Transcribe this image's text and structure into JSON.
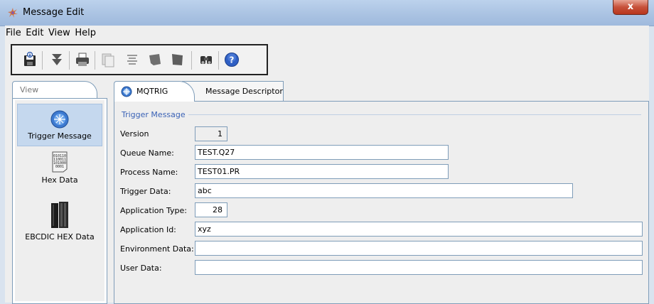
{
  "window": {
    "title": "Message Edit",
    "close_label": "x"
  },
  "menu": {
    "items": [
      "File",
      "Edit",
      "View",
      "Help"
    ]
  },
  "toolbar": {
    "icons": [
      "save-icon",
      "download-icon",
      "print-icon",
      "copy-icon",
      "align-icon",
      "paste-icon",
      "delete-icon",
      "find-icon",
      "help-icon"
    ]
  },
  "left_panel": {
    "tab_label": "View",
    "items": [
      {
        "label": "Trigger Message",
        "icon": "trigger-message-icon",
        "selected": true
      },
      {
        "label": "Hex Data",
        "icon": "hex-data-icon",
        "selected": false
      },
      {
        "label": "EBCDIC HEX Data",
        "icon": "ebcdic-hex-data-icon",
        "selected": false
      }
    ]
  },
  "tabs": [
    {
      "label": "MQTRIG",
      "active": true
    },
    {
      "label": "Message Descriptor",
      "active": false
    }
  ],
  "form": {
    "section_title": "Trigger Message",
    "fields": {
      "version": {
        "label": "Version",
        "value": "1"
      },
      "queue_name": {
        "label": "Queue Name:",
        "value": "TEST.Q27"
      },
      "process_name": {
        "label": "Process Name:",
        "value": "TEST01.PR"
      },
      "trigger_data": {
        "label": "Trigger Data:",
        "value": "abc"
      },
      "application_type": {
        "label": "Application Type:",
        "value": "28"
      },
      "application_id": {
        "label": "Application Id:",
        "value": "xyz"
      },
      "environment_data": {
        "label": "Environment Data:",
        "value": ""
      },
      "user_data": {
        "label": "User Data:",
        "value": ""
      }
    }
  },
  "colors": {
    "titlebar": "#a9c2e2",
    "close": "#c7513a",
    "section_title": "#3a62b6",
    "selection": "#c5d8ee"
  }
}
